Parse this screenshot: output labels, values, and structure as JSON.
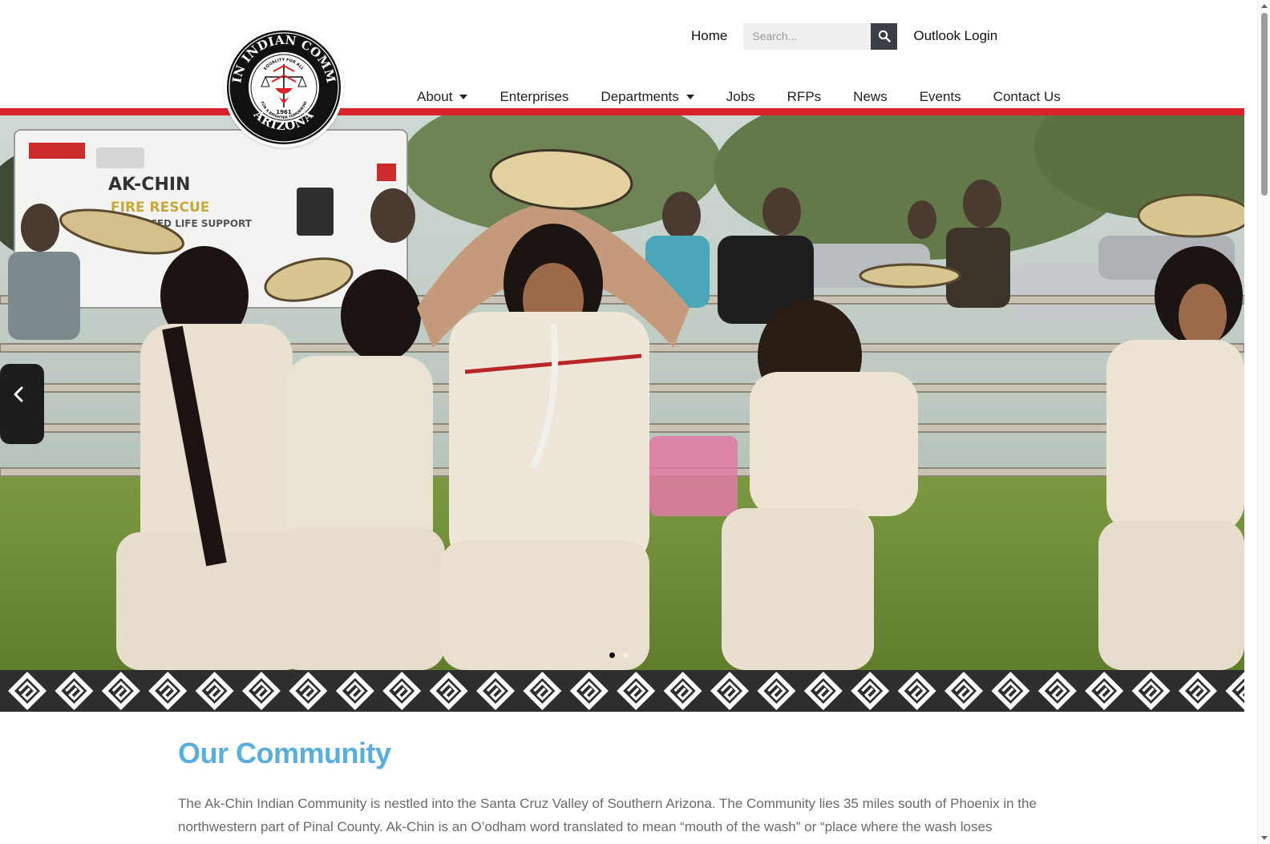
{
  "header": {
    "logo": {
      "ring_top_text": "AK-CHIN INDIAN COMMUNITY",
      "ring_bottom_text": "ARIZONA",
      "motto_top": "EQUALITY FOR ALL",
      "year": "1961",
      "motto_bottom": "FOR A BRIGHTER TOMORROW"
    },
    "utility": {
      "home_label": "Home",
      "search_placeholder": "Search...",
      "outlook_label": "Outlook Login"
    },
    "nav": [
      {
        "label": "About",
        "has_dropdown": true
      },
      {
        "label": "Enterprises",
        "has_dropdown": false
      },
      {
        "label": "Departments",
        "has_dropdown": true
      },
      {
        "label": "Jobs",
        "has_dropdown": false
      },
      {
        "label": "RFPs",
        "has_dropdown": false
      },
      {
        "label": "News",
        "has_dropdown": false
      },
      {
        "label": "Events",
        "has_dropdown": false
      },
      {
        "label": "Contact Us",
        "has_dropdown": false
      }
    ]
  },
  "hero": {
    "vehicle_text_1": "AK-CHIN",
    "vehicle_text_2": "FIRE RESCUE",
    "vehicle_text_3": "ADVANCED LIFE SUPPORT",
    "slide_count": 2,
    "active_slide": 1
  },
  "content": {
    "title": "Our Community",
    "body": "The Ak-Chin Indian Community is nestled into the Santa Cruz Valley of Southern Arizona. The Community lies 35 miles south of Phoenix in the northwestern part of Pinal County. Ak-Chin is an O’odham word translated to mean “mouth of the wash” or “place where the wash loses"
  },
  "colors": {
    "accent_red": "#d8232a",
    "title_blue": "#5aaedc",
    "band_dark": "#2e2e2e",
    "search_button": "#3b3e44"
  }
}
